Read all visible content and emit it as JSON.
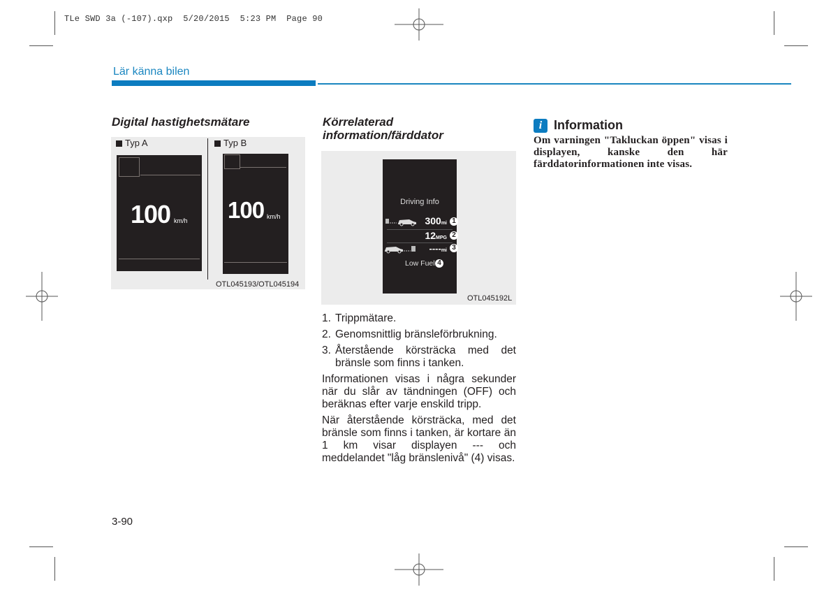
{
  "print_slug": "TLe SWD 3a (-107).qxp  5/20/2015  5:23 PM  Page 90",
  "section_header": "Lär känna bilen",
  "colors": {
    "accent": "#0c7cc0",
    "display_bg": "#231f20",
    "figure_bg": "#ececec"
  },
  "column1": {
    "heading": "Digital hastighetsmätare",
    "figure": {
      "type_a": {
        "label": "Typ A",
        "speed": "100",
        "unit": "km/h"
      },
      "type_b": {
        "label": "Typ B",
        "speed": "100",
        "unit": "km/h"
      },
      "code": "OTL045193/OTL045194"
    }
  },
  "column2": {
    "heading_line1": "Körrelaterad",
    "heading_line2": "information/färddator",
    "figure": {
      "title": "Driving Info",
      "rows": [
        {
          "value": "300",
          "unit": "mi",
          "marker": "1"
        },
        {
          "value": "12",
          "unit": "MPG",
          "marker": "2"
        },
        {
          "value": "----",
          "unit": "mi",
          "marker": "3"
        }
      ],
      "warning": "Low Fuel",
      "warning_marker": "4",
      "code": "OTL045192L"
    },
    "list": [
      {
        "num": "1.",
        "text": "Trippmätare."
      },
      {
        "num": "2.",
        "text": "Genomsnittlig bränsleförbrukning."
      },
      {
        "num": "3.",
        "text": "Återstående körsträcka med det bränsle som finns i tanken."
      }
    ],
    "paragraphs": [
      "Informationen visas i några sekunder när du slår av tändningen (OFF) och beräknas efter varje enskild tripp.",
      "När återstående körsträcka, med det bränsle som finns i tanken, är kortare än 1 km visar displayen --- och meddelandet \"låg bränslenivå\" (4) visas."
    ]
  },
  "column3": {
    "info_icon": "i",
    "info_title": "Information",
    "info_body": "Om varningen \"Takluckan öppen\" visas i displayen, kanske den här färddatorinformationen inte visas."
  },
  "page_number": "3-90"
}
